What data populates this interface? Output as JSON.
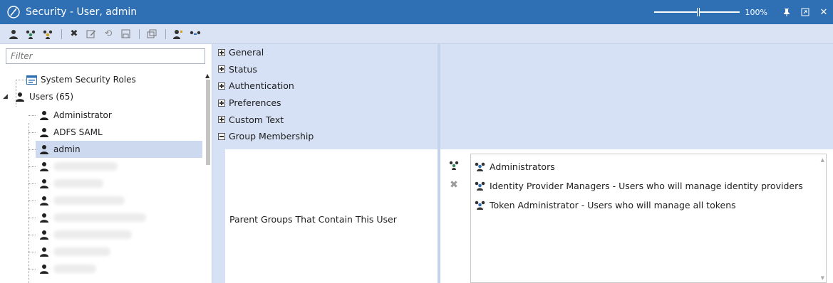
{
  "window": {
    "title": "Security - User, admin",
    "zoom_percent": 100,
    "zoom_label": "100%",
    "accent": "#2f6fb3"
  },
  "toolbar": {
    "icons": [
      "user-icon",
      "group-add-icon",
      "group-icon",
      "delete-icon",
      "edit-icon",
      "refresh-icon",
      "save-icon",
      "window-icon",
      "user-settings-icon",
      "user-link-icon"
    ]
  },
  "left": {
    "filter_placeholder": "Filter",
    "tree": {
      "system_roles": "System Security Roles",
      "users_node": "Users (65)",
      "users": [
        "Administrator",
        "ADFS SAML",
        "admin"
      ],
      "selected": "admin"
    }
  },
  "props": {
    "sections": [
      "General",
      "Status",
      "Authentication",
      "Preferences",
      "Custom Text",
      "Group Membership"
    ],
    "expanded_section": "Group Membership",
    "membership_label": "Parent Groups That Contain This User"
  },
  "groups": [
    "Administrators",
    "Identity Provider Managers - Users who will manage identity providers",
    "Token Administrator - Users who will manage all tokens"
  ],
  "colors": {
    "selection": "#ccd9ee",
    "section_bg": "#d6e1f5",
    "toolbar_bg": "#dae3f3"
  }
}
